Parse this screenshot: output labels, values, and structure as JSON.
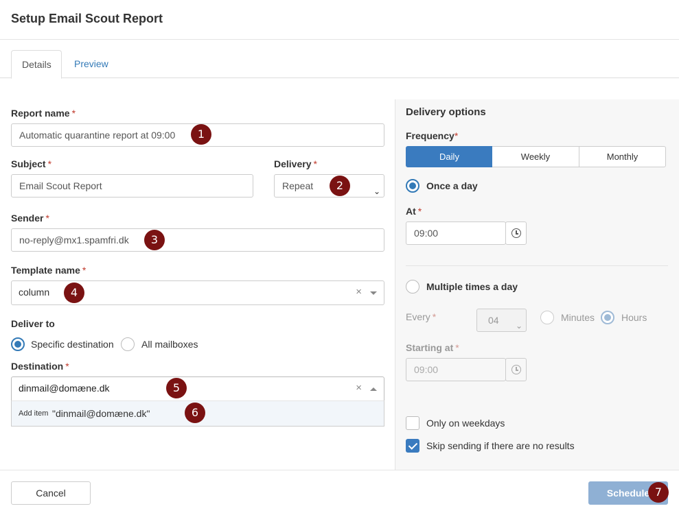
{
  "dialog": {
    "title": "Setup Email Scout Report"
  },
  "tabs": [
    {
      "label": "Details"
    },
    {
      "label": "Preview"
    }
  ],
  "form": {
    "report_name": {
      "label": "Report name",
      "required": "*",
      "value": "Automatic quarantine report at 09:00"
    },
    "subject": {
      "label": "Subject",
      "required": "*",
      "value": "Email Scout Report"
    },
    "delivery": {
      "label": "Delivery",
      "required": "*",
      "value": "Repeat"
    },
    "sender": {
      "label": "Sender",
      "required": "*",
      "value": "no-reply@mx1.spamfri.dk"
    },
    "template_name": {
      "label": "Template name",
      "required": "*",
      "value": "column",
      "clear": "×"
    },
    "deliver_to": {
      "label": "Deliver to",
      "options": [
        "Specific destination",
        "All mailboxes"
      ],
      "selected": "Specific destination"
    },
    "destination": {
      "label": "Destination",
      "required": "*",
      "value": "dinmail@domæne.dk",
      "clear": "×",
      "dropdown": {
        "prefix": "Add item",
        "value": "\"dinmail@domæne.dk\""
      }
    }
  },
  "delivery_options": {
    "title": "Delivery options",
    "frequency": {
      "label": "Frequency",
      "required": "*",
      "options": [
        "Daily",
        "Weekly",
        "Monthly"
      ],
      "selected": "Daily"
    },
    "once_a_day": {
      "label": "Once a day",
      "at_label": "At",
      "required": "*",
      "at_value": "09:00"
    },
    "multiple": {
      "label": "Multiple times a day",
      "every_label": "Every",
      "required": "*",
      "every_value": "04",
      "units": [
        "Minutes",
        "Hours"
      ],
      "unit_selected": "Hours",
      "starting_label": "Starting at",
      "starting_value": "09:00"
    },
    "only_weekdays": {
      "label": "Only on weekdays",
      "checked": false
    },
    "skip_no_results": {
      "label": "Skip sending if there are no results",
      "checked": true
    }
  },
  "footer": {
    "cancel_label": "Cancel",
    "schedule_label": "Schedule"
  },
  "badges": [
    "1",
    "2",
    "3",
    "4",
    "5",
    "6",
    "7"
  ],
  "colors": {
    "accent": "#3a7bbf",
    "badge": "#7a1212",
    "required": "#c0392b"
  }
}
